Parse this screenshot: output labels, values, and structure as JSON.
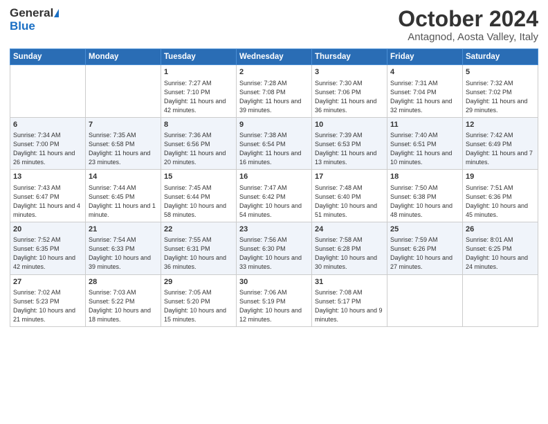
{
  "header": {
    "logo_line1": "General",
    "logo_line2": "Blue",
    "title": "October 2024",
    "subtitle": "Antagnod, Aosta Valley, Italy"
  },
  "days_of_week": [
    "Sunday",
    "Monday",
    "Tuesday",
    "Wednesday",
    "Thursday",
    "Friday",
    "Saturday"
  ],
  "weeks": [
    [
      {
        "day": "",
        "info": ""
      },
      {
        "day": "",
        "info": ""
      },
      {
        "day": "1",
        "info": "Sunrise: 7:27 AM\nSunset: 7:10 PM\nDaylight: 11 hours and 42 minutes."
      },
      {
        "day": "2",
        "info": "Sunrise: 7:28 AM\nSunset: 7:08 PM\nDaylight: 11 hours and 39 minutes."
      },
      {
        "day": "3",
        "info": "Sunrise: 7:30 AM\nSunset: 7:06 PM\nDaylight: 11 hours and 36 minutes."
      },
      {
        "day": "4",
        "info": "Sunrise: 7:31 AM\nSunset: 7:04 PM\nDaylight: 11 hours and 32 minutes."
      },
      {
        "day": "5",
        "info": "Sunrise: 7:32 AM\nSunset: 7:02 PM\nDaylight: 11 hours and 29 minutes."
      }
    ],
    [
      {
        "day": "6",
        "info": "Sunrise: 7:34 AM\nSunset: 7:00 PM\nDaylight: 11 hours and 26 minutes."
      },
      {
        "day": "7",
        "info": "Sunrise: 7:35 AM\nSunset: 6:58 PM\nDaylight: 11 hours and 23 minutes."
      },
      {
        "day": "8",
        "info": "Sunrise: 7:36 AM\nSunset: 6:56 PM\nDaylight: 11 hours and 20 minutes."
      },
      {
        "day": "9",
        "info": "Sunrise: 7:38 AM\nSunset: 6:54 PM\nDaylight: 11 hours and 16 minutes."
      },
      {
        "day": "10",
        "info": "Sunrise: 7:39 AM\nSunset: 6:53 PM\nDaylight: 11 hours and 13 minutes."
      },
      {
        "day": "11",
        "info": "Sunrise: 7:40 AM\nSunset: 6:51 PM\nDaylight: 11 hours and 10 minutes."
      },
      {
        "day": "12",
        "info": "Sunrise: 7:42 AM\nSunset: 6:49 PM\nDaylight: 11 hours and 7 minutes."
      }
    ],
    [
      {
        "day": "13",
        "info": "Sunrise: 7:43 AM\nSunset: 6:47 PM\nDaylight: 11 hours and 4 minutes."
      },
      {
        "day": "14",
        "info": "Sunrise: 7:44 AM\nSunset: 6:45 PM\nDaylight: 11 hours and 1 minute."
      },
      {
        "day": "15",
        "info": "Sunrise: 7:45 AM\nSunset: 6:44 PM\nDaylight: 10 hours and 58 minutes."
      },
      {
        "day": "16",
        "info": "Sunrise: 7:47 AM\nSunset: 6:42 PM\nDaylight: 10 hours and 54 minutes."
      },
      {
        "day": "17",
        "info": "Sunrise: 7:48 AM\nSunset: 6:40 PM\nDaylight: 10 hours and 51 minutes."
      },
      {
        "day": "18",
        "info": "Sunrise: 7:50 AM\nSunset: 6:38 PM\nDaylight: 10 hours and 48 minutes."
      },
      {
        "day": "19",
        "info": "Sunrise: 7:51 AM\nSunset: 6:36 PM\nDaylight: 10 hours and 45 minutes."
      }
    ],
    [
      {
        "day": "20",
        "info": "Sunrise: 7:52 AM\nSunset: 6:35 PM\nDaylight: 10 hours and 42 minutes."
      },
      {
        "day": "21",
        "info": "Sunrise: 7:54 AM\nSunset: 6:33 PM\nDaylight: 10 hours and 39 minutes."
      },
      {
        "day": "22",
        "info": "Sunrise: 7:55 AM\nSunset: 6:31 PM\nDaylight: 10 hours and 36 minutes."
      },
      {
        "day": "23",
        "info": "Sunrise: 7:56 AM\nSunset: 6:30 PM\nDaylight: 10 hours and 33 minutes."
      },
      {
        "day": "24",
        "info": "Sunrise: 7:58 AM\nSunset: 6:28 PM\nDaylight: 10 hours and 30 minutes."
      },
      {
        "day": "25",
        "info": "Sunrise: 7:59 AM\nSunset: 6:26 PM\nDaylight: 10 hours and 27 minutes."
      },
      {
        "day": "26",
        "info": "Sunrise: 8:01 AM\nSunset: 6:25 PM\nDaylight: 10 hours and 24 minutes."
      }
    ],
    [
      {
        "day": "27",
        "info": "Sunrise: 7:02 AM\nSunset: 5:23 PM\nDaylight: 10 hours and 21 minutes."
      },
      {
        "day": "28",
        "info": "Sunrise: 7:03 AM\nSunset: 5:22 PM\nDaylight: 10 hours and 18 minutes."
      },
      {
        "day": "29",
        "info": "Sunrise: 7:05 AM\nSunset: 5:20 PM\nDaylight: 10 hours and 15 minutes."
      },
      {
        "day": "30",
        "info": "Sunrise: 7:06 AM\nSunset: 5:19 PM\nDaylight: 10 hours and 12 minutes."
      },
      {
        "day": "31",
        "info": "Sunrise: 7:08 AM\nSunset: 5:17 PM\nDaylight: 10 hours and 9 minutes."
      },
      {
        "day": "",
        "info": ""
      },
      {
        "day": "",
        "info": ""
      }
    ]
  ]
}
